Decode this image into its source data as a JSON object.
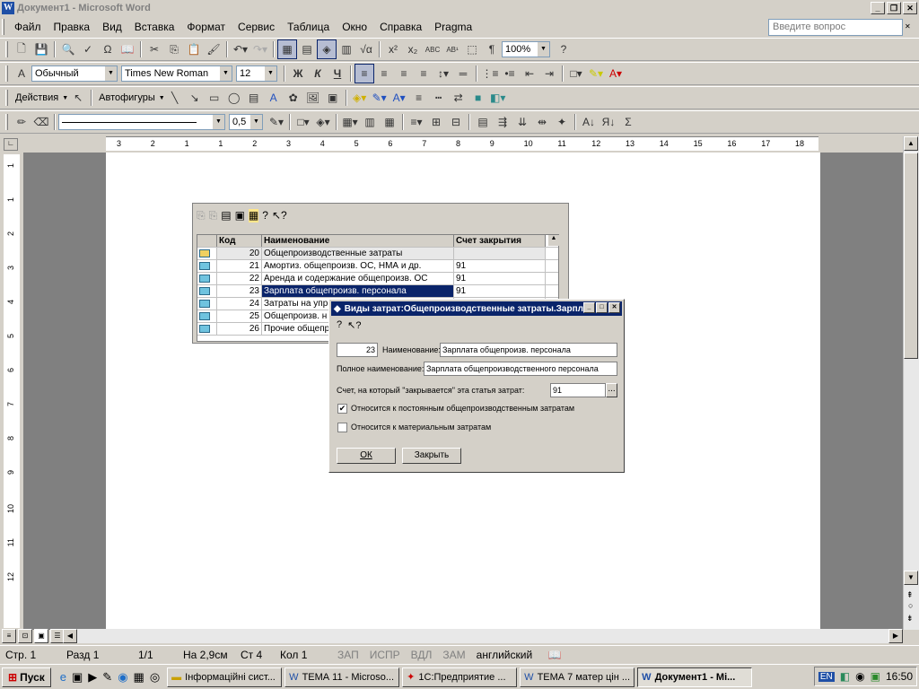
{
  "window": {
    "title": "Документ1 - Microsoft Word",
    "app_icon_letter": "W"
  },
  "menu": {
    "items": [
      "Файл",
      "Правка",
      "Вид",
      "Вставка",
      "Формат",
      "Сервис",
      "Таблица",
      "Окно",
      "Справка",
      "Pragma"
    ],
    "ask_placeholder": "Введите вопрос"
  },
  "toolbar": {
    "zoom": "100%",
    "style": "Обычный",
    "font": "Times New Roman",
    "size": "12",
    "bold": "Ж",
    "italic": "К",
    "underline": "Ч",
    "sum": "Σ",
    "line_width": "0,5",
    "drawing_label": "Действия",
    "autoshapes_label": "Автофигуры"
  },
  "ruler": {
    "marks": [
      "3",
      "2",
      "1",
      "1",
      "2",
      "3",
      "4",
      "5",
      "6",
      "7",
      "8",
      "9",
      "10",
      "11",
      "12",
      "13",
      "14",
      "15",
      "16",
      "17",
      "18"
    ],
    "vmarks": [
      "1",
      "1",
      "2",
      "3",
      "4",
      "5",
      "6",
      "7",
      "8",
      "9",
      "10",
      "11",
      "12"
    ]
  },
  "catalog": {
    "columns": [
      "Код",
      "Наименование",
      "Счет закрытия"
    ],
    "rows": [
      {
        "code": "20",
        "name": "Общепроизводственные затраты",
        "account": "",
        "group": true
      },
      {
        "code": "21",
        "name": "Амортиз. общепроизв. ОС, НМА и др.",
        "account": "91"
      },
      {
        "code": "22",
        "name": "Аренда и содержание общепроизв. ОС",
        "account": "91"
      },
      {
        "code": "23",
        "name": "Зарплата общепроизв. персонала",
        "account": "91",
        "selected": true
      },
      {
        "code": "24",
        "name": "Затраты на упр",
        "account": ""
      },
      {
        "code": "25",
        "name": "Общепроизв. н",
        "account": ""
      },
      {
        "code": "26",
        "name": "Прочие общепр",
        "account": ""
      }
    ]
  },
  "dialog": {
    "title": "Виды затрат:Общепроизводственные затраты.Зарпл...",
    "code_value": "23",
    "name_label": "Наименование:",
    "name_value": "Зарплата общепроизв. персонала",
    "fullname_label": "Полное наименование:",
    "fullname_value": "Зарплата общепроизводственного персонала",
    "account_label": "Счет, на который \"закрывается\" эта статья затрат:",
    "account_value": "91",
    "check1_label": "Относится к постоянным общепроизводственным затратам",
    "check1_checked": true,
    "check2_label": "Относится к материальным затратам",
    "check2_checked": false,
    "ok_label": "ОК",
    "close_label": "Закрыть"
  },
  "status": {
    "page": "Стр. 1",
    "section": "Разд 1",
    "pages": "1/1",
    "position": "На 2,9см",
    "line": "Ст 4",
    "column": "Кол 1",
    "rec": "ЗАП",
    "trk": "ИСПР",
    "ext": "ВДЛ",
    "ovr": "ЗАМ",
    "language": "английский"
  },
  "taskbar": {
    "start": "Пуск",
    "tasks": [
      "Інформаційні сист...",
      "ТЕМА 11 - Microso...",
      "1С:Предприятие ...",
      "ТЕМА 7 матер цін ...",
      "Документ1 - Mi..."
    ],
    "lang": "EN",
    "time": "16:50"
  }
}
